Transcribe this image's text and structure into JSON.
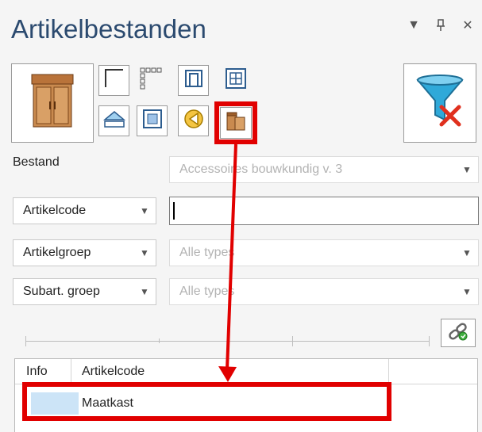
{
  "window": {
    "title": "Artikelbestanden",
    "icons": [
      "dropdown-icon",
      "pin-icon",
      "close-icon"
    ]
  },
  "toolbar": {
    "buttons": [
      "cabinet-icon",
      "corner-profile-icon",
      "dotted-frame-icon",
      "door-frame-icon",
      "grid-panel-icon",
      "hatch-icon",
      "panel-icon",
      "hinge-icon",
      "cabinet-set-icon",
      "filter-clear-icon"
    ]
  },
  "form": {
    "bestand_label": "Bestand",
    "bestand_value": "Accessoires bouwkundig v. 3",
    "artikelcode_label": "Artikelcode",
    "artikelcode_value": "",
    "artikelgroep_label": "Artikelgroep",
    "artikelgroep_value": "Alle types",
    "subart_label": "Subart. groep",
    "subart_value": "Alle types"
  },
  "grid": {
    "columns": [
      "Info",
      "Artikelcode"
    ],
    "rows": [
      {
        "info": "",
        "artikelcode": "Maatkast"
      }
    ]
  },
  "colors": {
    "highlight": "#e10000",
    "title": "#2b4a6f",
    "selection": "#cce4f7"
  }
}
